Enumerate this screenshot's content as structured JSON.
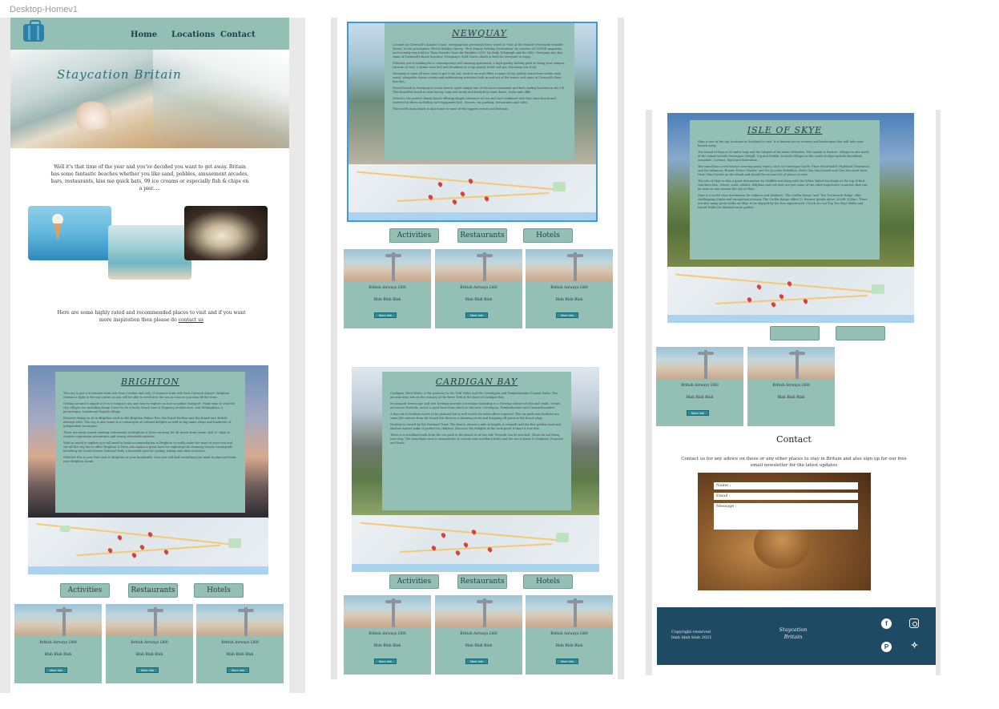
{
  "canvas": {
    "frame_label": "Desktop-Homev1"
  },
  "header": {
    "nav": [
      "Home",
      "Locations",
      "Contact"
    ],
    "hero_title": "Staycation Britain",
    "icon": "suitcase-logo-icon"
  },
  "intro_text": "Well it's that time of the year and you've decided you want to get away.  Britain has some fantastic beaches whether you like sand, pebbles, amusement arcades, bars, restaurants, kiss me quick hats, 99 ice creams or especially fish & chips on a pier.....",
  "recommend_text": "Here are some highly rated and recommended places to visit and if you want more inspiration then please do",
  "recommend_link": "contact us",
  "destinations": [
    {
      "title": "BRIGHTON",
      "paragraphs": [
        "The city is just a 60-minute train ride from London and only 30 minutes train ride from Gatwick Airport. Brighton Station is right in the city centre so you will be able to stroll into the sea as soon as you step off the train.",
        "Getting around is simple as it is a compact city and easy to explore on foot or public transport. Make time to visit the city villages too including Kemp Town for its eclectic beach bars & Regency architecture, and Rottingdean, a picturesque, traditional English village.",
        "Discover things to do in Brighton such as the Brighton Palace Pier, the Royal Pavilion and the brand new British Airways i360. The city is also home to a cornucopia of cultural delights as well as big name shops and hundreds of independent boutiques.",
        "There are many award-winning restaurants in Brighton & Hove catering for all tastes from classic fish 'n' chips to creative vegetarian restaurants and trendy streetside eateries.",
        "With so much to explore you will need to book accommodation in Brighton to really make the most of your visit and see all the city has to offer. Brighton & Hove also makes a great base for exploring the stunning Sussex countryside including the South Downs National Park, a beautiful spot for cycling, hiking and other activities.",
        "Whether this is your first visit to Brighton or your hundredth, here you will find everything you need to plan and book your Brighton break."
      ]
    },
    {
      "title": "NEWQUAY",
      "paragraphs": [
        "Located on Cornwall's Atlantic Coast, Newquay has previously been voted as \"One of the Nation's Favourite Seaside Towns\" in the prestigious Which Holiday Survey, \"Best Family Holiday Destination\" by readers of CONDE magazine, and recently was fold for \"Best Seaside Town for Families 2019\" by Daily Telegraph and the Mile. Newquay also has some of Cornwall's finest beaches! Newquay's Gold Coach charts is best for everyone to enjoy.",
        "Whether you're looking for a contemporary self catering apartment, a high quality holiday park to bring your camper, caravan or tent, a prime view bed and breakfast or a top quality hotel and spa, Newquay has it all.",
        "Newquay is open all year, easy to get to by rail, road or air and offers a range of top quality attractions within easy reach, alongside classic events and exhilarating activities both in and out of the water, and some of Cornwall's best beaches.",
        "Fistral beach in Newquay is iconic beach, quite simply one of the most consistent and best surfing beaches in the UK. This beautiful beach is near facing, long and sandy and backed by sand dunes, rocks and cliffs.",
        "Fistral is the perfect family beach offering simple pleasures of sea and surf combined with first class beach and seafront facilities including surf equipment hire, lessons, car parking, restaurants and cafes.",
        "This world class beach is also home to some of the biggest events and festivals."
      ]
    },
    {
      "title": "CARDIGAN BAY",
      "paragraphs": [
        "Cardigan, West Wales, is the gateway to the Teifi Valley and the Ceredigion and Pembrokeshire Coastal Paths. The ancient town sits on the estuary of the River Teifi at the base of Cardigan Bay.",
        "Its unspoilt townscape and rich heritage provide a nostalgic backdrop to a thriving culture of arts and crafts, events and music festivals, and is a good base from which to discover Ceredigion, Pembrokeshire and Carmarthenshire.",
        "A day out at Penbryn needs to be planned but is well worth the extra effort required. The car park and facilities are some 400 metres from the beach but there is a stunning circle and dropping off point at the beach edge.",
        "Penbryn is owned by the National Trust. The beach, almost a mile in length, is unspoilt and the fine golden sand and shallow waters make it perfect for children. Discover the delights of the rock pools if there is low tide.",
        "There is a woodland walk from the car park to the beach or at low tide Tresaith can be reached. Those do not bring your dog. The immediate area is sympathetic to coastal and woodland birds and the sea is home to Dolphins, Porpoise and Seals."
      ]
    },
    {
      "title": "ISLE OF SKYE",
      "paragraphs": [
        "Skye is one of the top locations in Scotland to visit. It is famous for its scenery and landscapes that will take your breath away.",
        "The Island of Skye is 50 miles long and the largest of the Inner Hebrides. The capital is Portree. Villages in the north of the island include Dunvegan, Idrigill, Uig and Staffin. Notable villages in the south of Skye include Broadford, Armadale, Carbost, Elgol and Sulevaline.",
        "The island has a rich history covering many topics, such as Dunvegan Castle, Flora MacDonald, Highland Clearances and the infamous 'Bonnie Prince Charlie' and the Jacobite Rebellion. Both Clan MacDonald and Clan MacLeod have their Clan Castles on the island and should be on your list of places to visit.",
        "The Isle of Skye is also a great destination for Wildlife watching with the White Tailed Sea Eagle at the top of bird watchers lists. Otters, seals, whales, dolphins and red deer are just some of the other impressive creatures that can be seen on and around the isle of Skye.",
        "Skye is a world class destination for walkers and climbers. 'The Cuillin Range' and 'The Trotternish Ridge' offer challenging climbs and exceptional scenery. The Cuillin Range offers 12 Munros (peaks above 3000ft /914m). There are also many great walks on Skye to be enjoyed by the less experienced. Check out our Top Ten Skye Walks and Island Walks for detailed route guides."
      ]
    }
  ],
  "tabs": {
    "activities": "Activities",
    "restaurants": "Restaurants",
    "hotels": "Hotels"
  },
  "card": {
    "title": "British Airways i360",
    "text": "Blah Blah Blah",
    "button": "More Info"
  },
  "contact": {
    "title": "Contact",
    "text": "Contact us for any advice on these or any other places to stay in Britain and also sign up for our free email newsletter for the latest updates",
    "name_label": "Name :",
    "email_label": "Email :",
    "message_label": "Message :"
  },
  "footer": {
    "copyright": "Copyright reserved",
    "copyright_line2": "blah blah blah 2021",
    "brand_line1": "Staycation",
    "brand_line2": "Britain",
    "social": [
      "facebook-icon",
      "instagram-icon",
      "pinterest-icon",
      "twitter-icon"
    ]
  },
  "colors": {
    "accent": "#93bfb5",
    "footer": "#1f4a63",
    "button": "#2f8a9a",
    "selection": "#3d9bd8"
  }
}
